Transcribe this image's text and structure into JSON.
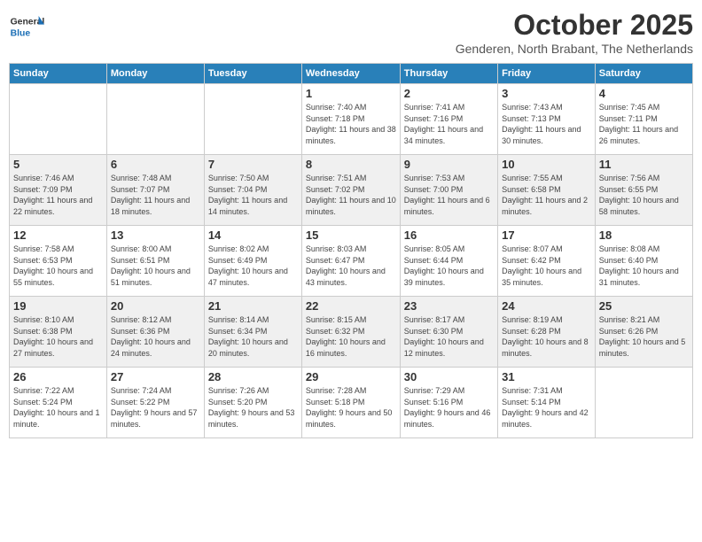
{
  "logo": {
    "general": "General",
    "blue": "Blue"
  },
  "header": {
    "month": "October 2025",
    "location": "Genderen, North Brabant, The Netherlands"
  },
  "days_of_week": [
    "Sunday",
    "Monday",
    "Tuesday",
    "Wednesday",
    "Thursday",
    "Friday",
    "Saturday"
  ],
  "weeks": [
    [
      {
        "day": "",
        "sunrise": "",
        "sunset": "",
        "daylight": ""
      },
      {
        "day": "",
        "sunrise": "",
        "sunset": "",
        "daylight": ""
      },
      {
        "day": "",
        "sunrise": "",
        "sunset": "",
        "daylight": ""
      },
      {
        "day": "1",
        "sunrise": "Sunrise: 7:40 AM",
        "sunset": "Sunset: 7:18 PM",
        "daylight": "Daylight: 11 hours and 38 minutes."
      },
      {
        "day": "2",
        "sunrise": "Sunrise: 7:41 AM",
        "sunset": "Sunset: 7:16 PM",
        "daylight": "Daylight: 11 hours and 34 minutes."
      },
      {
        "day": "3",
        "sunrise": "Sunrise: 7:43 AM",
        "sunset": "Sunset: 7:13 PM",
        "daylight": "Daylight: 11 hours and 30 minutes."
      },
      {
        "day": "4",
        "sunrise": "Sunrise: 7:45 AM",
        "sunset": "Sunset: 7:11 PM",
        "daylight": "Daylight: 11 hours and 26 minutes."
      }
    ],
    [
      {
        "day": "5",
        "sunrise": "Sunrise: 7:46 AM",
        "sunset": "Sunset: 7:09 PM",
        "daylight": "Daylight: 11 hours and 22 minutes."
      },
      {
        "day": "6",
        "sunrise": "Sunrise: 7:48 AM",
        "sunset": "Sunset: 7:07 PM",
        "daylight": "Daylight: 11 hours and 18 minutes."
      },
      {
        "day": "7",
        "sunrise": "Sunrise: 7:50 AM",
        "sunset": "Sunset: 7:04 PM",
        "daylight": "Daylight: 11 hours and 14 minutes."
      },
      {
        "day": "8",
        "sunrise": "Sunrise: 7:51 AM",
        "sunset": "Sunset: 7:02 PM",
        "daylight": "Daylight: 11 hours and 10 minutes."
      },
      {
        "day": "9",
        "sunrise": "Sunrise: 7:53 AM",
        "sunset": "Sunset: 7:00 PM",
        "daylight": "Daylight: 11 hours and 6 minutes."
      },
      {
        "day": "10",
        "sunrise": "Sunrise: 7:55 AM",
        "sunset": "Sunset: 6:58 PM",
        "daylight": "Daylight: 11 hours and 2 minutes."
      },
      {
        "day": "11",
        "sunrise": "Sunrise: 7:56 AM",
        "sunset": "Sunset: 6:55 PM",
        "daylight": "Daylight: 10 hours and 58 minutes."
      }
    ],
    [
      {
        "day": "12",
        "sunrise": "Sunrise: 7:58 AM",
        "sunset": "Sunset: 6:53 PM",
        "daylight": "Daylight: 10 hours and 55 minutes."
      },
      {
        "day": "13",
        "sunrise": "Sunrise: 8:00 AM",
        "sunset": "Sunset: 6:51 PM",
        "daylight": "Daylight: 10 hours and 51 minutes."
      },
      {
        "day": "14",
        "sunrise": "Sunrise: 8:02 AM",
        "sunset": "Sunset: 6:49 PM",
        "daylight": "Daylight: 10 hours and 47 minutes."
      },
      {
        "day": "15",
        "sunrise": "Sunrise: 8:03 AM",
        "sunset": "Sunset: 6:47 PM",
        "daylight": "Daylight: 10 hours and 43 minutes."
      },
      {
        "day": "16",
        "sunrise": "Sunrise: 8:05 AM",
        "sunset": "Sunset: 6:44 PM",
        "daylight": "Daylight: 10 hours and 39 minutes."
      },
      {
        "day": "17",
        "sunrise": "Sunrise: 8:07 AM",
        "sunset": "Sunset: 6:42 PM",
        "daylight": "Daylight: 10 hours and 35 minutes."
      },
      {
        "day": "18",
        "sunrise": "Sunrise: 8:08 AM",
        "sunset": "Sunset: 6:40 PM",
        "daylight": "Daylight: 10 hours and 31 minutes."
      }
    ],
    [
      {
        "day": "19",
        "sunrise": "Sunrise: 8:10 AM",
        "sunset": "Sunset: 6:38 PM",
        "daylight": "Daylight: 10 hours and 27 minutes."
      },
      {
        "day": "20",
        "sunrise": "Sunrise: 8:12 AM",
        "sunset": "Sunset: 6:36 PM",
        "daylight": "Daylight: 10 hours and 24 minutes."
      },
      {
        "day": "21",
        "sunrise": "Sunrise: 8:14 AM",
        "sunset": "Sunset: 6:34 PM",
        "daylight": "Daylight: 10 hours and 20 minutes."
      },
      {
        "day": "22",
        "sunrise": "Sunrise: 8:15 AM",
        "sunset": "Sunset: 6:32 PM",
        "daylight": "Daylight: 10 hours and 16 minutes."
      },
      {
        "day": "23",
        "sunrise": "Sunrise: 8:17 AM",
        "sunset": "Sunset: 6:30 PM",
        "daylight": "Daylight: 10 hours and 12 minutes."
      },
      {
        "day": "24",
        "sunrise": "Sunrise: 8:19 AM",
        "sunset": "Sunset: 6:28 PM",
        "daylight": "Daylight: 10 hours and 8 minutes."
      },
      {
        "day": "25",
        "sunrise": "Sunrise: 8:21 AM",
        "sunset": "Sunset: 6:26 PM",
        "daylight": "Daylight: 10 hours and 5 minutes."
      }
    ],
    [
      {
        "day": "26",
        "sunrise": "Sunrise: 7:22 AM",
        "sunset": "Sunset: 5:24 PM",
        "daylight": "Daylight: 10 hours and 1 minute."
      },
      {
        "day": "27",
        "sunrise": "Sunrise: 7:24 AM",
        "sunset": "Sunset: 5:22 PM",
        "daylight": "Daylight: 9 hours and 57 minutes."
      },
      {
        "day": "28",
        "sunrise": "Sunrise: 7:26 AM",
        "sunset": "Sunset: 5:20 PM",
        "daylight": "Daylight: 9 hours and 53 minutes."
      },
      {
        "day": "29",
        "sunrise": "Sunrise: 7:28 AM",
        "sunset": "Sunset: 5:18 PM",
        "daylight": "Daylight: 9 hours and 50 minutes."
      },
      {
        "day": "30",
        "sunrise": "Sunrise: 7:29 AM",
        "sunset": "Sunset: 5:16 PM",
        "daylight": "Daylight: 9 hours and 46 minutes."
      },
      {
        "day": "31",
        "sunrise": "Sunrise: 7:31 AM",
        "sunset": "Sunset: 5:14 PM",
        "daylight": "Daylight: 9 hours and 42 minutes."
      },
      {
        "day": "",
        "sunrise": "",
        "sunset": "",
        "daylight": ""
      }
    ]
  ]
}
